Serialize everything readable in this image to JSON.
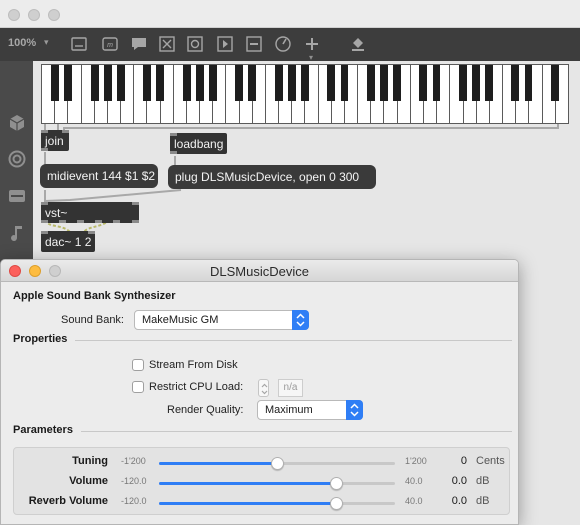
{
  "patcher": {
    "zoom": "100%",
    "toolbar_icons": [
      "new-object-icon",
      "message-icon",
      "comment-icon",
      "button-icon",
      "toggle-icon",
      "playbar-icon",
      "slider-icon",
      "dial-icon",
      "add-icon",
      "paint-bucket-icon"
    ],
    "sidebar_icons": [
      "package-icon",
      "audio-icon",
      "device-icon",
      "music-note-icon"
    ],
    "objects": {
      "join": "join",
      "loadbang": "loadbang",
      "vst": "vst~",
      "dac": "dac~ 1 2"
    },
    "messages": {
      "midievent": "midievent 144 $1 $2",
      "plug": "plug DLSMusicDevice, open 0 300"
    },
    "kslider": {
      "white_keys": 40
    }
  },
  "plugin_window": {
    "title": "DLSMusicDevice",
    "synth_name": "Apple Sound Bank Synthesizer",
    "sound_bank_label": "Sound Bank:",
    "sound_bank_value": "MakeMusic GM",
    "properties_header": "Properties",
    "stream_from_disk_label": "Stream From Disk",
    "stream_from_disk_checked": false,
    "restrict_cpu_label": "Restrict CPU Load:",
    "restrict_cpu_checked": false,
    "restrict_cpu_value": "n/a",
    "render_quality_label": "Render Quality:",
    "render_quality_value": "Maximum",
    "parameters_header": "Parameters",
    "parameters": [
      {
        "name": "Tuning",
        "min_label": "-1'200",
        "max_label": "1'200",
        "value": "0",
        "unit": "Cents",
        "level": 0.5
      },
      {
        "name": "Volume",
        "min_label": "-120.0",
        "max_label": "40.0",
        "value": "0.0",
        "unit": "dB",
        "level": 0.75
      },
      {
        "name": "Reverb Volume",
        "min_label": "-120.0",
        "max_label": "40.0",
        "value": "0.0",
        "unit": "dB",
        "level": 0.75
      }
    ]
  },
  "colors": {
    "accent_blue": "#2f7ef5",
    "object_bg": "#333333",
    "toolbar_bg": "#3d3d3d",
    "patch_cord": "#a8a8a8",
    "close_red": "#fc605c",
    "minimize_yellow": "#fdbc40"
  }
}
